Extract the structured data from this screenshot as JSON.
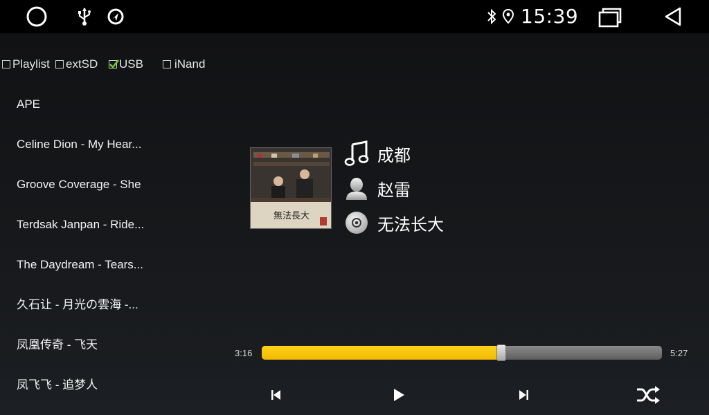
{
  "status_bar": {
    "time": "15:39",
    "left_icons": [
      "home-circle-icon",
      "usb-icon",
      "gps-nav-icon"
    ],
    "right_icons": [
      "bluetooth-icon",
      "location-pin-icon"
    ],
    "nav_icons": [
      "recent-apps-icon",
      "back-icon"
    ]
  },
  "sources": [
    {
      "label": "Playlist",
      "checked": false
    },
    {
      "label": "extSD",
      "checked": false
    },
    {
      "label": "USB",
      "checked": true
    },
    {
      "label": "iNand",
      "checked": false
    }
  ],
  "track_list": [
    "APE",
    "Celine Dion - My Hear...",
    "Groove Coverage - She",
    "Terdsak Janpan - Ride...",
    "The Daydream - Tears...",
    "久石让 - 月光の雲海 -...",
    "凤凰传奇 - 飞天",
    "凤飞飞 - 追梦人"
  ],
  "now_playing": {
    "title": "成都",
    "artist": "赵雷",
    "album": "无法长大",
    "album_art_text": "無法長大"
  },
  "progress": {
    "elapsed": "3:16",
    "total": "5:27",
    "fraction": 0.599
  },
  "controls": [
    "previous-icon",
    "play-icon",
    "next-icon",
    "shuffle-icon"
  ],
  "colors": {
    "accent": "#f5c000",
    "status_bar": "#000000",
    "background": "#141517"
  }
}
